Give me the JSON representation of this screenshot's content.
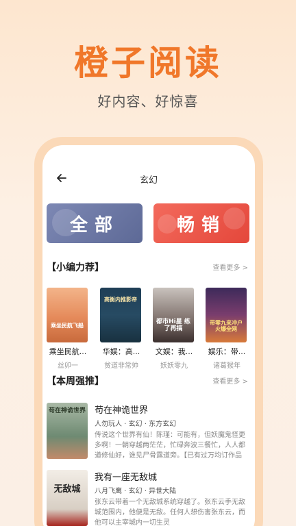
{
  "hero": {
    "title": "橙子阅读",
    "subtitle": "好内容、好惊喜"
  },
  "topbar": {
    "title": "玄幻"
  },
  "categories": [
    {
      "label": "全部"
    },
    {
      "label": "畅销"
    }
  ],
  "recommend": {
    "title": "【小编力荐】",
    "more": "查看更多 >",
    "books": [
      {
        "title": "乘坐民航...",
        "author": "丝卯一",
        "cover_text": "乘坐民航飞船"
      },
      {
        "title": "华娱：高...",
        "author": "贫道非常帅",
        "cover_text": "高衡内推影帝"
      },
      {
        "title": "文娱：我...",
        "author": "妖妖零九",
        "cover_text": "都市Hi星 练了再搞"
      },
      {
        "title": "娱乐：带...",
        "author": "诸葛猴年",
        "cover_text": "带零九来冲户 火爆全网"
      }
    ]
  },
  "weekly": {
    "title": "【本周强推】",
    "more": "查看更多 >",
    "books": [
      {
        "title": "苟在神诡世界",
        "meta": "人勿玩人 · 玄幻 · 东方玄幻",
        "desc": "传说这个世界有仙！陈瑾：可能有，但妖魔鬼怪更多啊！一朝穿越两茫茫，忙碌奔波三餐忙，人人都道修仙好，谁见尸骨露道旁。【已有过万均订作品《晴",
        "cover_text": "苟在神诡世界"
      },
      {
        "title": "我有一座无敌城",
        "meta": "八月飞鹰 · 玄幻 · 异世大陆",
        "desc": "张东云带着一个无敌城系统穿越了。张东云手无敌城范围内，他便是无敌。任何人想伤害张东云，而他可以主宰城内一切生灵",
        "cover_text": "无敌城"
      }
    ]
  }
}
